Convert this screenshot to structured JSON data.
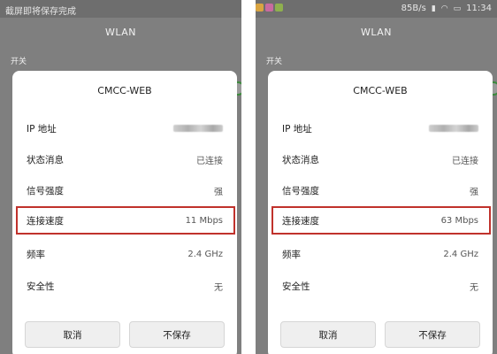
{
  "screens": [
    {
      "status": {
        "left_text": "截屏即将保存完成",
        "speed": "",
        "time": ""
      },
      "page_title": "WLAN",
      "section_label": "开关",
      "dialog": {
        "title": "CMCC-WEB",
        "rows": [
          {
            "label": "IP 地址",
            "value": ""
          },
          {
            "label": "状态消息",
            "value": "已连接"
          },
          {
            "label": "信号强度",
            "value": "强"
          },
          {
            "label": "连接速度",
            "value": "11 Mbps"
          },
          {
            "label": "频率",
            "value": "2.4 GHz"
          },
          {
            "label": "安全性",
            "value": "无"
          }
        ],
        "cancel_label": "取消",
        "nosave_label": "不保存"
      }
    },
    {
      "status": {
        "left_text": "",
        "speed": "85B/s",
        "time": "11:34"
      },
      "page_title": "WLAN",
      "section_label": "开关",
      "dialog": {
        "title": "CMCC-WEB",
        "rows": [
          {
            "label": "IP 地址",
            "value": ""
          },
          {
            "label": "状态消息",
            "value": "已连接"
          },
          {
            "label": "信号强度",
            "value": "强"
          },
          {
            "label": "连接速度",
            "value": "63 Mbps"
          },
          {
            "label": "频率",
            "value": "2.4 GHz"
          },
          {
            "label": "安全性",
            "value": "无"
          }
        ],
        "cancel_label": "取消",
        "nosave_label": "不保存"
      }
    }
  ],
  "colors": {
    "highlight": "#c0322c",
    "overlay": "#7f7f7f",
    "toggle_on": "#3c8a3c"
  },
  "icons": [
    "signal-icon",
    "wifi-icon",
    "battery-icon",
    "lock-icon"
  ]
}
